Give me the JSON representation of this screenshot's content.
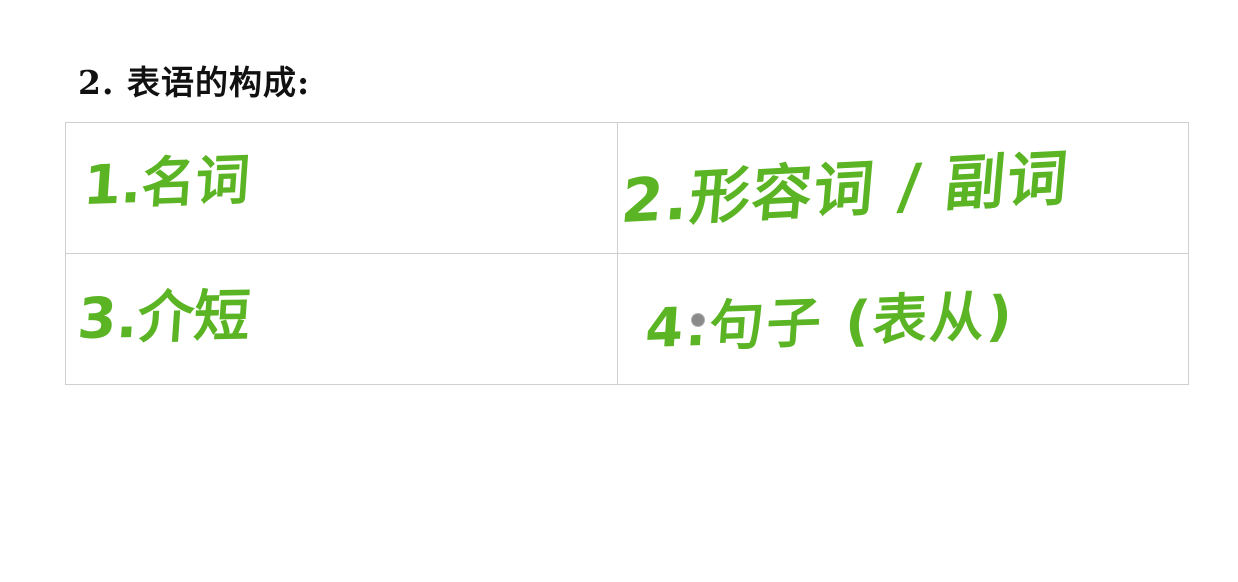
{
  "heading": {
    "text": "2. 表语的构成:"
  },
  "table": {
    "rows": [
      [
        "1.名词",
        "2.形容词 / 副词"
      ],
      [
        "3.介短",
        "4.句子 (表从)"
      ]
    ]
  },
  "colors": {
    "handwriting": "#5ab423",
    "grid_border": "#cfcfcf",
    "heading_text": "#111111"
  }
}
